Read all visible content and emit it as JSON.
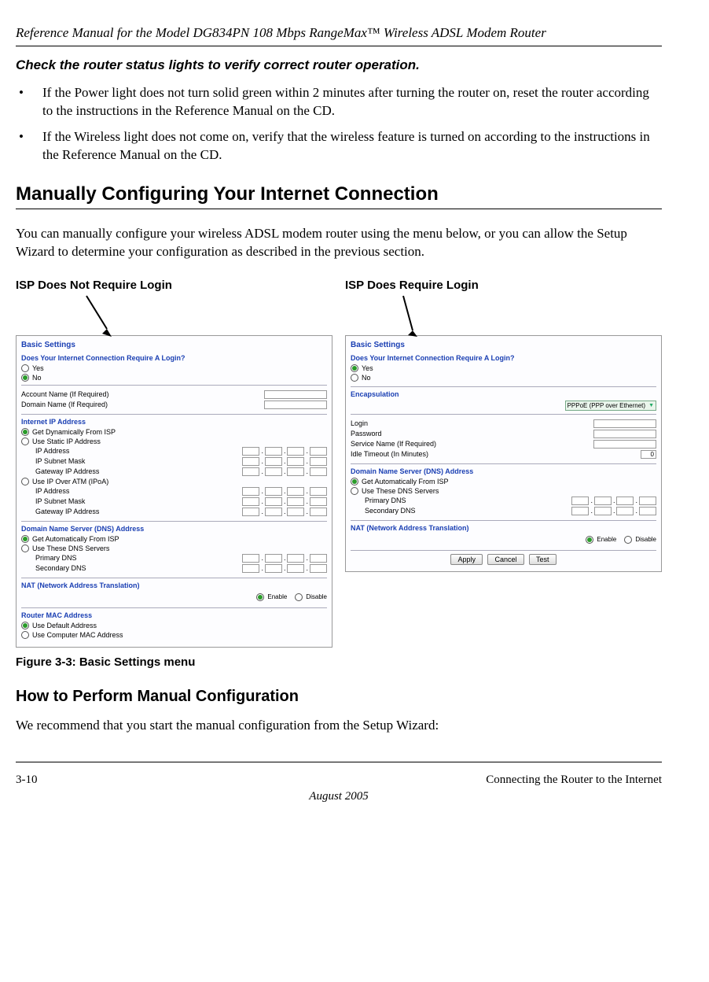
{
  "header": {
    "title": "Reference Manual for the Model DG834PN 108 Mbps RangeMax™ Wireless ADSL Modem Router"
  },
  "step": {
    "title": "Check the router status lights to verify correct router operation."
  },
  "bullets": [
    "If the Power light does not turn solid green within 2 minutes after turning the router on, reset the router according to the instructions in the Reference Manual on the CD.",
    "If the Wireless light does not come on, verify that the wireless feature is turned on according to the instructions in the Reference Manual on the CD."
  ],
  "h1": "Manually Configuring Your Internet Connection",
  "intro": "You can manually configure your wireless ADSL modem router using the menu below, or you can allow the Setup Wizard to determine your configuration as described in the previous section.",
  "fig": {
    "leftCaption": "ISP Does Not Require Login",
    "rightCaption": "ISP Does Require Login",
    "caption": "Figure 3-3:  Basic Settings menu",
    "panelTitle": "Basic Settings",
    "q": "Does Your Internet Connection Require A Login?",
    "yes": "Yes",
    "no": "No",
    "left": {
      "acct": "Account Name  (If Required)",
      "dom": "Domain Name  (If Required)",
      "ipHead": "Internet IP Address",
      "getDyn": "Get Dynamically From ISP",
      "useStatic": "Use Static IP Address",
      "ipaddr": "IP Address",
      "subnet": "IP Subnet Mask",
      "gw": "Gateway IP Address",
      "ipoa": "Use IP Over ATM (IPoA)",
      "dnsHead": "Domain Name Server (DNS) Address",
      "dnsAuto": "Get Automatically From ISP",
      "dnsUse": "Use These DNS Servers",
      "pdns": "Primary DNS",
      "sdns": "Secondary DNS",
      "natHead": "NAT (Network Address Translation)",
      "enable": "Enable",
      "disable": "Disable",
      "macHead": "Router MAC Address",
      "macDef": "Use Default Address",
      "macComp": "Use Computer MAC Address"
    },
    "right": {
      "encHead": "Encapsulation",
      "encSel": "PPPoE (PPP over Ethernet)",
      "login": "Login",
      "pw": "Password",
      "svc": "Service Name (If Required)",
      "idle": "Idle Timeout (In Minutes)",
      "idleVal": "0",
      "dnsHead": "Domain Name Server (DNS) Address",
      "dnsAuto": "Get Automatically From ISP",
      "dnsUse": "Use These DNS Servers",
      "pdns": "Primary DNS",
      "sdns": "Secondary DNS",
      "natHead": "NAT (Network Address Translation)",
      "enable": "Enable",
      "disable": "Disable",
      "apply": "Apply",
      "cancel": "Cancel",
      "test": "Test"
    }
  },
  "h2": "How to Perform Manual Configuration",
  "p2": "We recommend that you start the manual configuration from the Setup Wizard:",
  "footer": {
    "left": "3-10",
    "right": "Connecting the Router to the Internet",
    "date": "August 2005"
  }
}
